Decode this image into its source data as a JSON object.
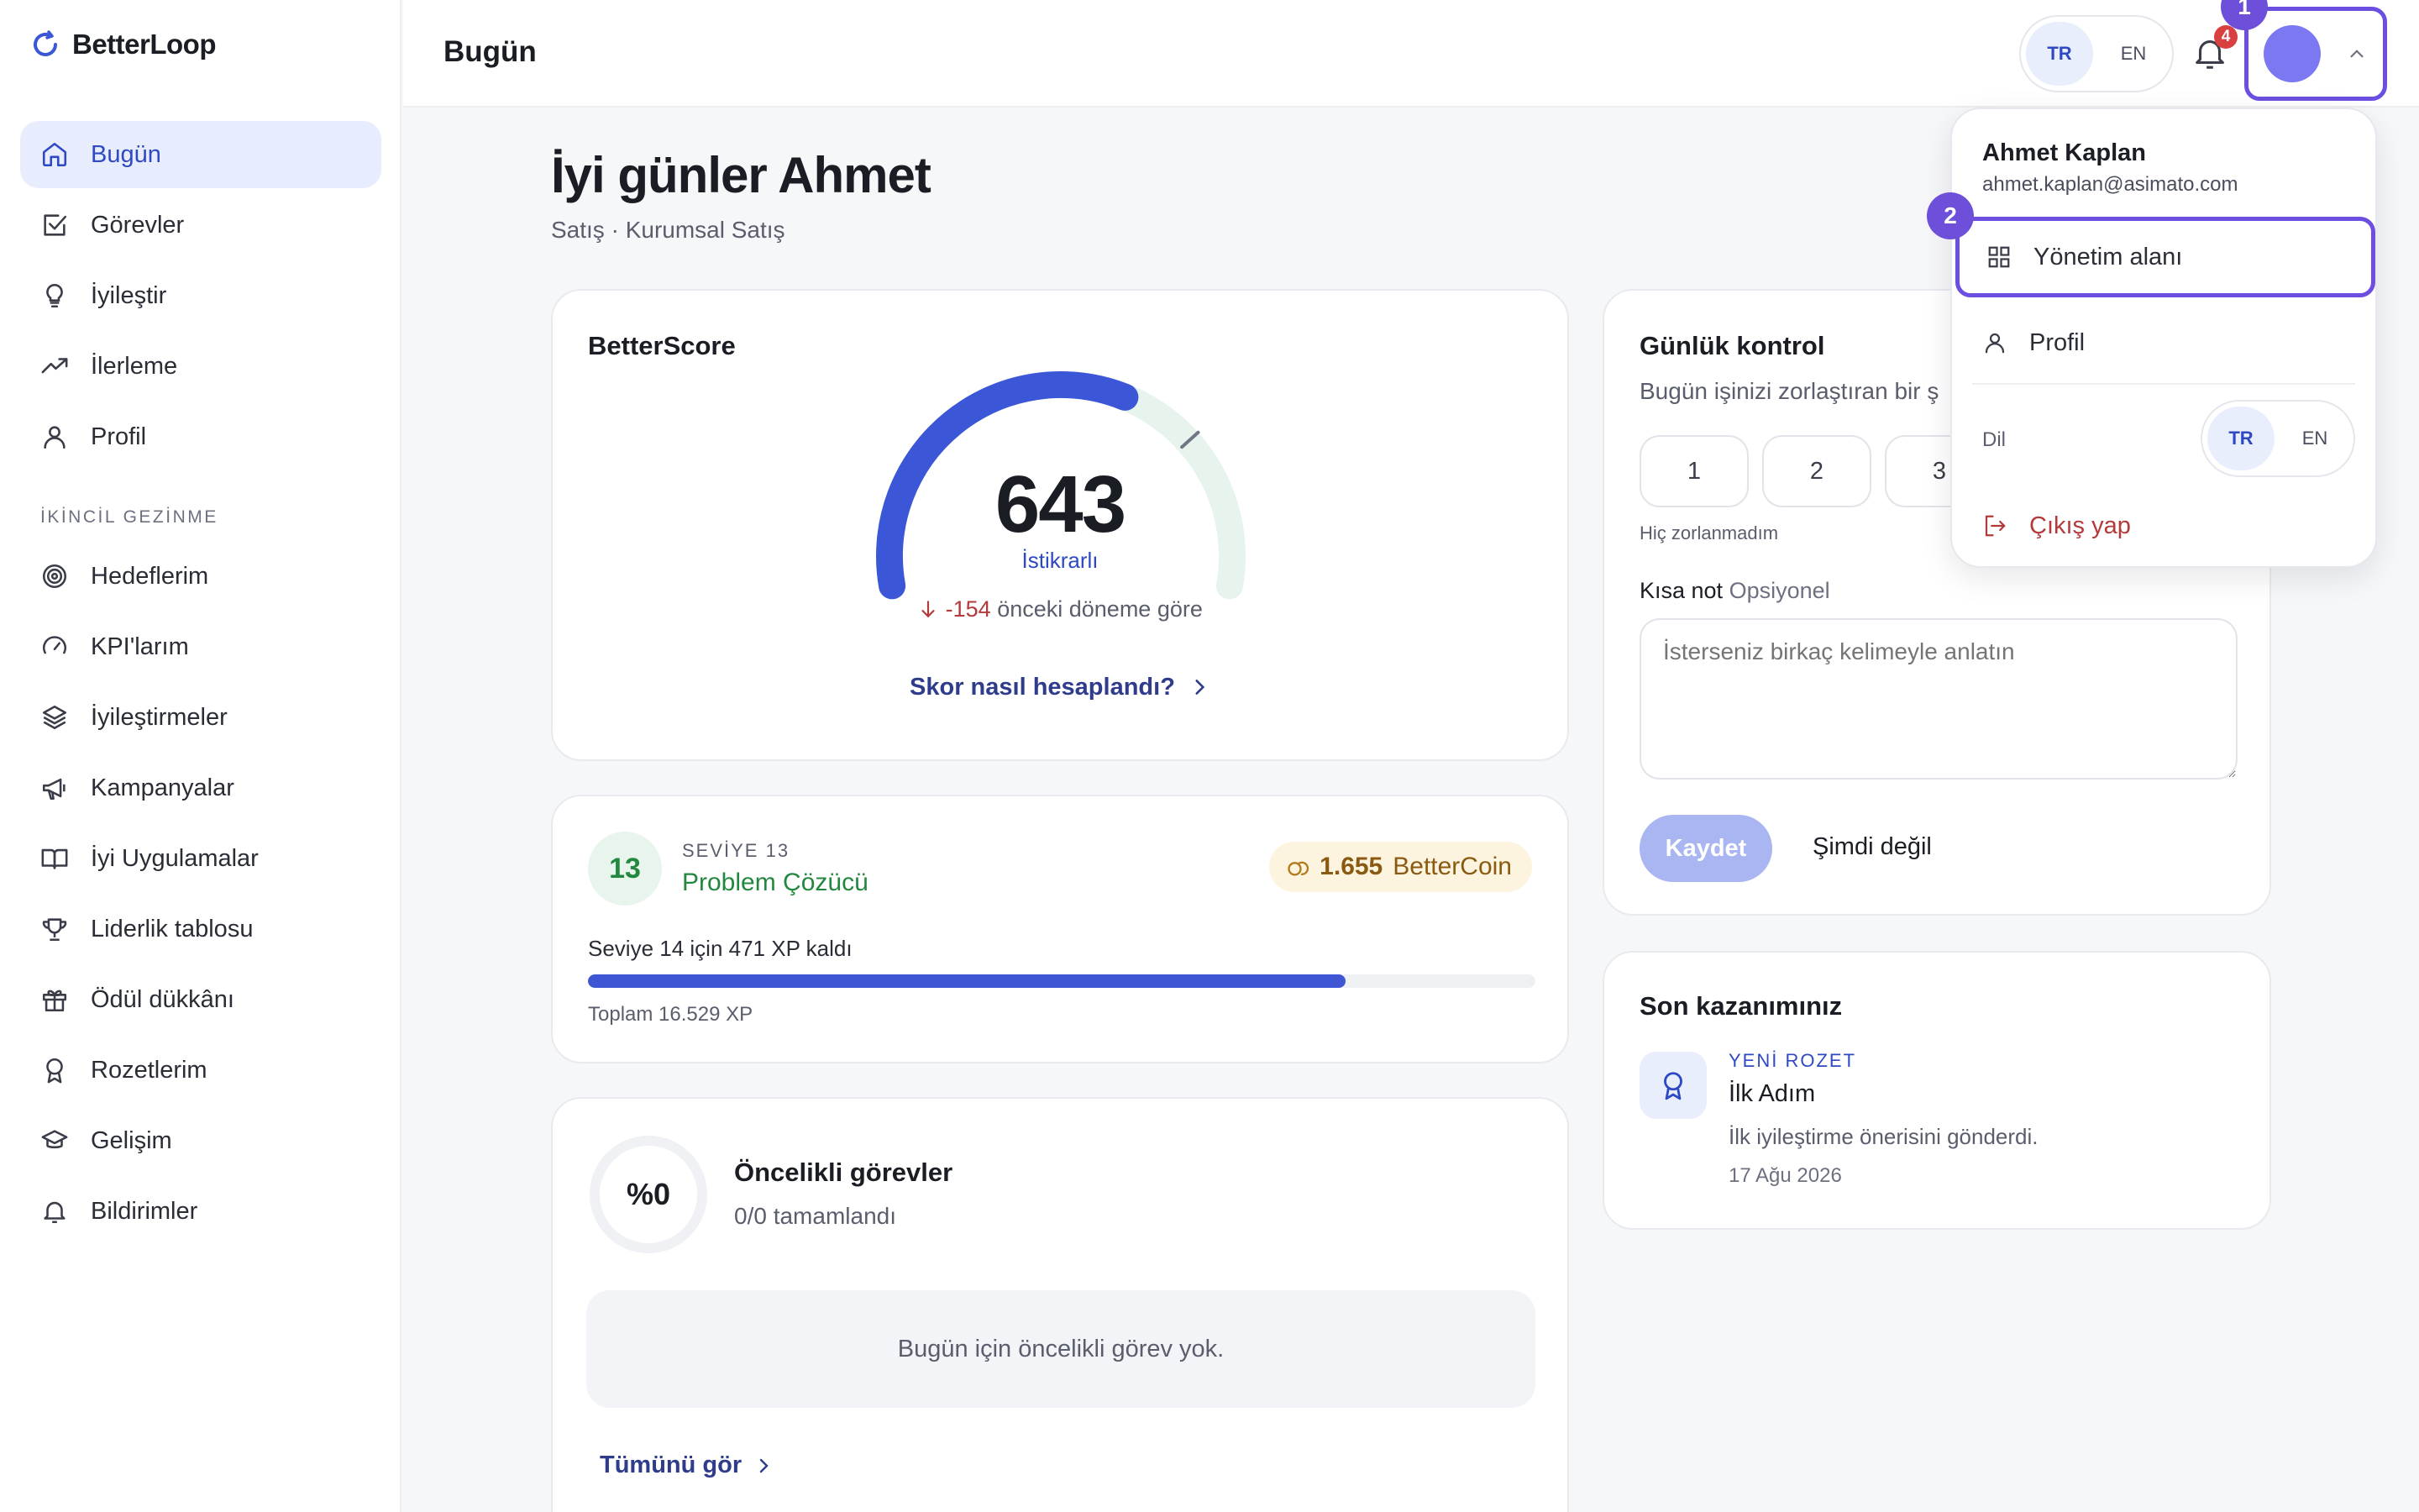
{
  "app": {
    "name": "BetterLoop"
  },
  "sidebar": {
    "items": [
      {
        "label": "Bugün",
        "icon": "home-icon",
        "active": true
      },
      {
        "label": "Görevler",
        "icon": "checkbox-icon"
      },
      {
        "label": "İyileştir",
        "icon": "lightbulb-icon"
      },
      {
        "label": "İlerleme",
        "icon": "trend-up-icon"
      },
      {
        "label": "Profil",
        "icon": "user-icon"
      }
    ],
    "secondary_label": "İKİNCİL GEZİNME",
    "secondary_items": [
      {
        "label": "Hedeflerim",
        "icon": "target-icon"
      },
      {
        "label": "KPI'larım",
        "icon": "gauge-icon"
      },
      {
        "label": "İyileştirmeler",
        "icon": "layers-icon"
      },
      {
        "label": "Kampanyalar",
        "icon": "megaphone-icon"
      },
      {
        "label": "İyi Uygulamalar",
        "icon": "book-icon"
      },
      {
        "label": "Liderlik tablosu",
        "icon": "trophy-icon"
      },
      {
        "label": "Ödül dükkânı",
        "icon": "gift-icon"
      },
      {
        "label": "Rozetlerim",
        "icon": "award-icon"
      },
      {
        "label": "Gelişim",
        "icon": "graduation-cap-icon"
      },
      {
        "label": "Bildirimler",
        "icon": "bell-icon"
      }
    ]
  },
  "header": {
    "title": "Bugün",
    "lang": {
      "tr": "TR",
      "en": "EN",
      "active": "TR"
    },
    "notification_count": "4",
    "step_badge": "1"
  },
  "greeting": {
    "title": "İyi günler Ahmet",
    "subtitle": "Satış · Kurumsal Satış"
  },
  "score": {
    "title": "BetterScore",
    "value": "643",
    "status": "İstikrarlı",
    "change_value": "-154",
    "change_text": "önceki döneme göre",
    "link": "Skor nasıl hesaplandı?",
    "gauge_fraction": 0.72,
    "colors": {
      "arc": "#3b57d8",
      "track": "#e7f4ee"
    }
  },
  "level": {
    "number": "13",
    "label": "SEVİYE 13",
    "name": "Problem Çözücü",
    "coins": "1.655",
    "coin_unit": "BetterCoin",
    "xp_left": "Seviye 14 için 471 XP kaldı",
    "xp_fraction": 0.8,
    "xp_total": "Toplam 16.529 XP"
  },
  "tasks": {
    "percent": "%0",
    "title": "Öncelikli görevler",
    "subtitle": "0/0 tamamlandı",
    "empty": "Bugün için öncelikli görev yok.",
    "link": "Tümünü gör"
  },
  "daily": {
    "title": "Günlük kontrol",
    "question": "Bugün işinizi zorlaştıran bir ş",
    "ratings": [
      "1",
      "2",
      "3"
    ],
    "hint": "Hiç zorlanmadım",
    "note_label": "Kısa not",
    "note_optional": "Opsiyonel",
    "note_placeholder": "İsterseniz birkaç kelimeyle anlatın",
    "save": "Kaydet",
    "later": "Şimdi değil"
  },
  "gains": {
    "title": "Son kazanımınız",
    "kicker": "YENİ ROZET",
    "name": "İlk Adım",
    "desc": "İlk iyileştirme önerisini gönderdi.",
    "date": "17 Ağu 2026"
  },
  "menu": {
    "name": "Ahmet Kaplan",
    "email": "ahmet.kaplan@asimato.com",
    "admin": "Yönetim alanı",
    "profile": "Profil",
    "lang_label": "Dil",
    "lang_tr": "TR",
    "lang_en": "EN",
    "logout": "Çıkış yap",
    "step_badge": "2"
  }
}
